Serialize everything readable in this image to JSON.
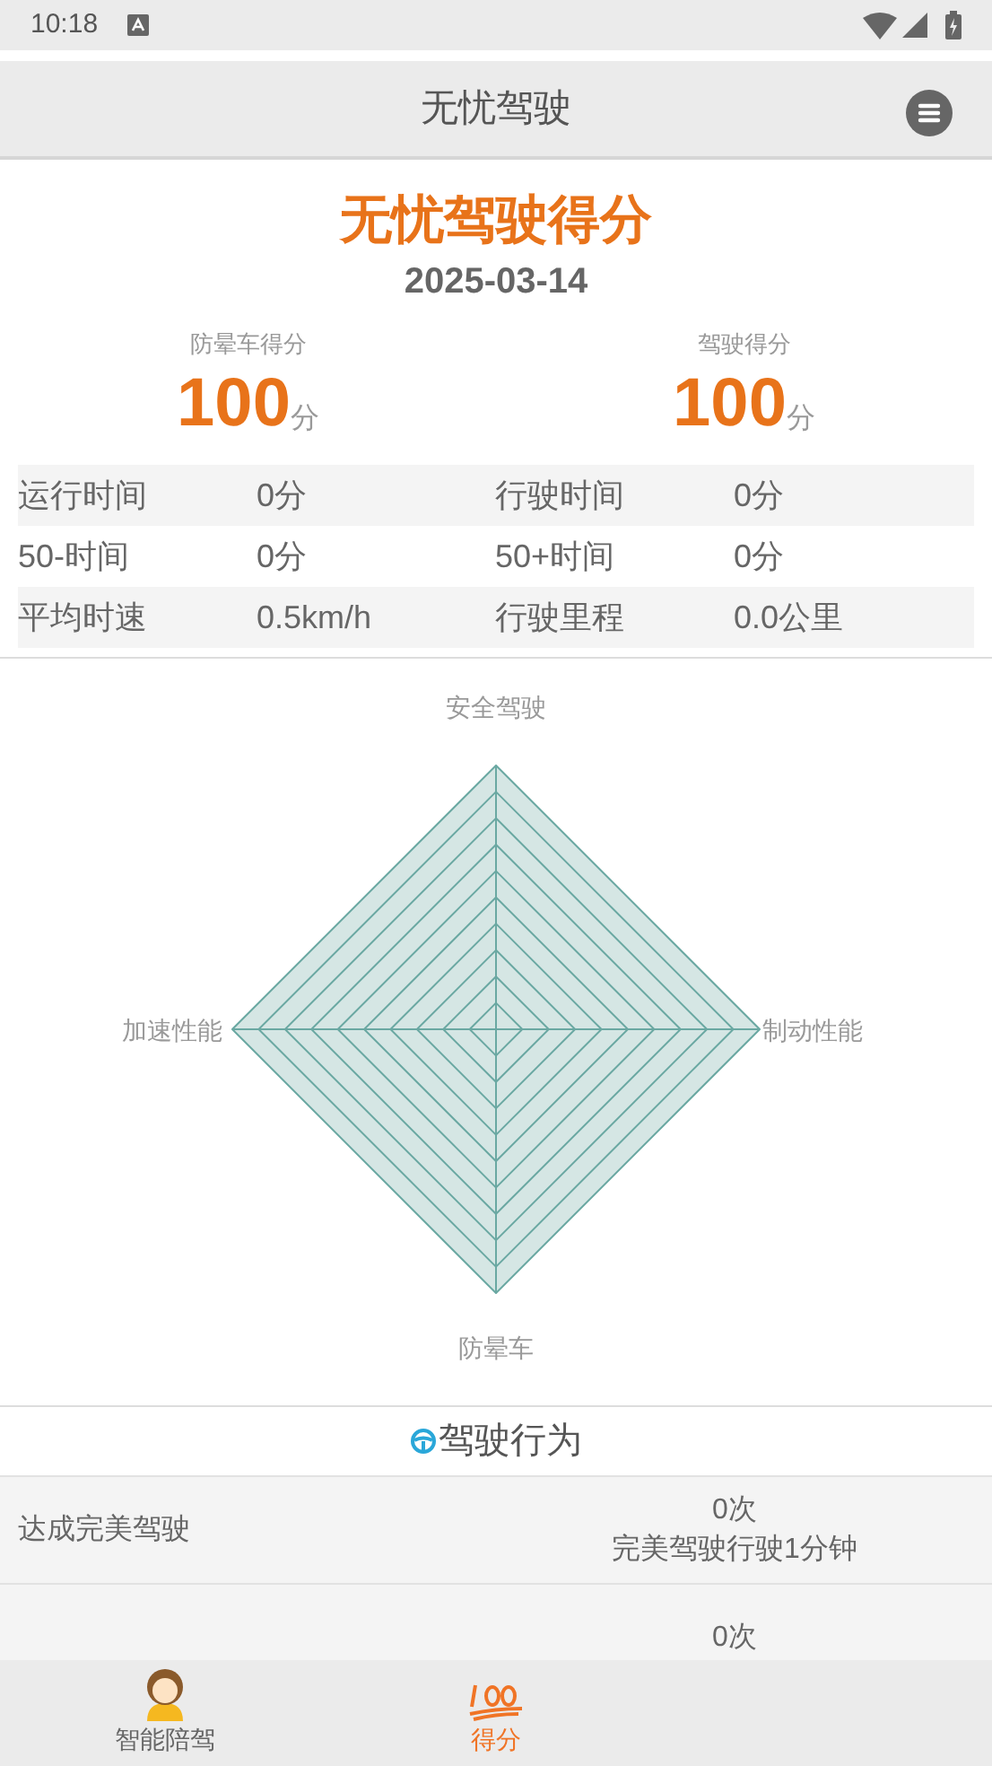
{
  "status_bar": {
    "time": "10:18"
  },
  "header": {
    "title": "无忧驾驶"
  },
  "summary": {
    "title": "无忧驾驶得分",
    "date": "2025-03-14",
    "scores": [
      {
        "label": "防晕车得分",
        "value": "100",
        "unit": "分"
      },
      {
        "label": "驾驶得分",
        "value": "100",
        "unit": "分"
      }
    ],
    "stats": [
      [
        "运行时间",
        "0分",
        "行驶时间",
        "0分"
      ],
      [
        "50-时间",
        "0分",
        "50+时间",
        "0分"
      ],
      [
        "平均时速",
        "0.5km/h",
        "行驶里程",
        "0.0公里"
      ]
    ]
  },
  "radar": {
    "axes": [
      "安全驾驶",
      "制动性能",
      "防晕车",
      "加速性能"
    ]
  },
  "behavior": {
    "title": "驾驶行为",
    "rows": [
      {
        "label": "达成完美驾驶",
        "count": "0次",
        "note": "完美驾驶行驶1分钟"
      },
      {
        "count": "0次"
      }
    ]
  },
  "nav": [
    {
      "label": "智能陪驾",
      "kind": "avatar",
      "selected": false
    },
    {
      "label": "得分",
      "kind": "hundred",
      "selected": true
    }
  ]
}
